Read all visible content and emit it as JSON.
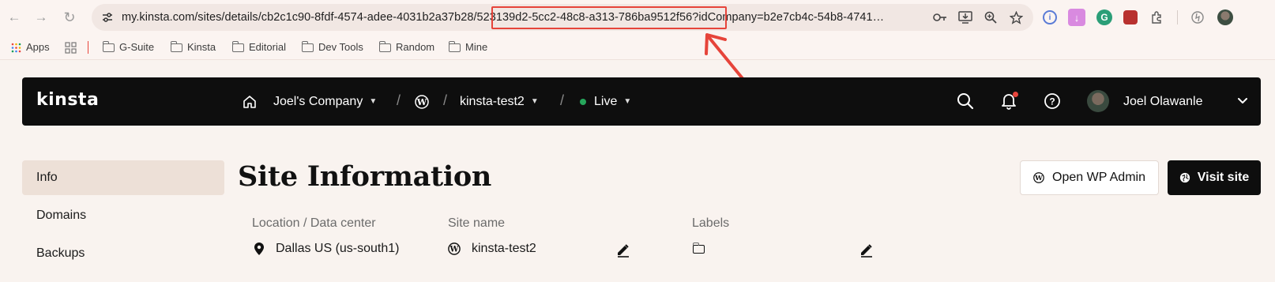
{
  "browser": {
    "url": "my.kinsta.com/sites/details/cb2c1c90-8fdf-4574-adee-4031b2a37b28/523139d2-5cc2-48c8-a313-786ba9512f56?idCompany=b2e7cb4c-54b8-4741…",
    "bookmarks": [
      "Apps",
      "G-Suite",
      "Kinsta",
      "Editorial",
      "Dev Tools",
      "Random",
      "Mine"
    ],
    "highlight_color": "#e6443a"
  },
  "nav": {
    "logo": "kinsta",
    "company": "Joel's Company",
    "site": "kinsta-test2",
    "environment": "Live",
    "user_name": "Joel Olawanle",
    "live_color": "#26a65b"
  },
  "sidebar": {
    "items": [
      {
        "label": "Info",
        "active": true
      },
      {
        "label": "Domains",
        "active": false
      },
      {
        "label": "Backups",
        "active": false
      }
    ]
  },
  "main": {
    "title": "Site Information",
    "open_wp_admin": "Open WP Admin",
    "visit_site": "Visit site",
    "location_label": "Location / Data center",
    "location_value": "Dallas US (us-south1)",
    "site_name_label": "Site name",
    "site_name_value": "kinsta-test2",
    "labels_label": "Labels"
  }
}
